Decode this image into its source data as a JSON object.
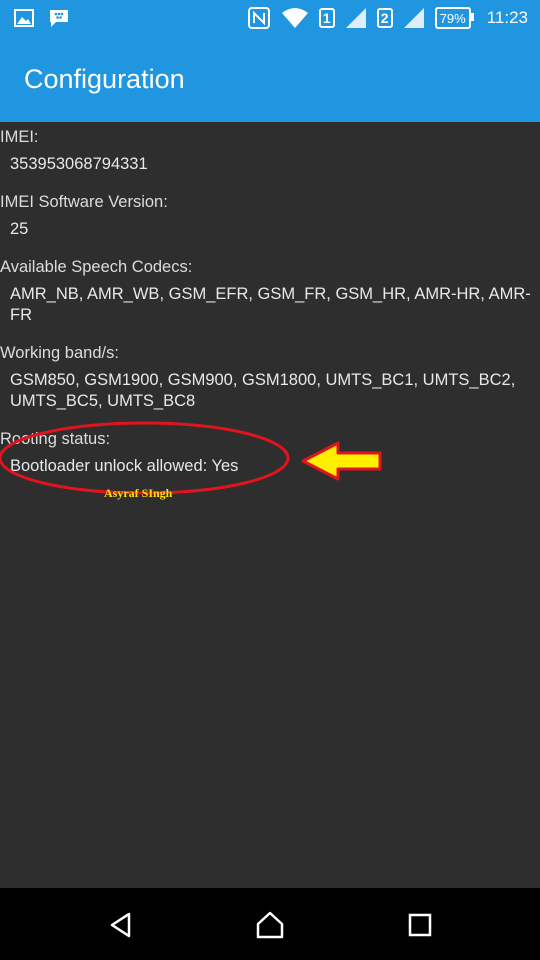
{
  "status_bar": {
    "sim1": "1",
    "sim2": "2",
    "battery": "79%",
    "time": "11:23",
    "icons": [
      "gallery-icon",
      "bbm-icon",
      "nfc-icon",
      "wifi-icon",
      "signal-icon",
      "battery-icon"
    ]
  },
  "app_bar": {
    "title": "Configuration",
    "color": "#2196e0"
  },
  "sections": [
    {
      "label": "IMEI:",
      "value": "353953068794331"
    },
    {
      "label": "IMEI Software Version:",
      "value": "25"
    },
    {
      "label": "Available Speech Codecs:",
      "value": "AMR_NB, AMR_WB, GSM_EFR, GSM_FR, GSM_HR, AMR-HR, AMR-FR"
    },
    {
      "label": "Working band/s:",
      "value": "GSM850, GSM1900, GSM900, GSM1800, UMTS_BC1, UMTS_BC2, UMTS_BC5, UMTS_BC8"
    },
    {
      "label": "Rooting status:",
      "value": "Bootloader unlock allowed: Yes"
    }
  ],
  "annotation": {
    "watermark": "Asyraf SIngh",
    "ellipse_color": "#e0141e",
    "arrow_color": "#ffee00"
  },
  "nav_bar": {
    "buttons": [
      "back-icon",
      "home-icon",
      "recents-icon"
    ]
  }
}
